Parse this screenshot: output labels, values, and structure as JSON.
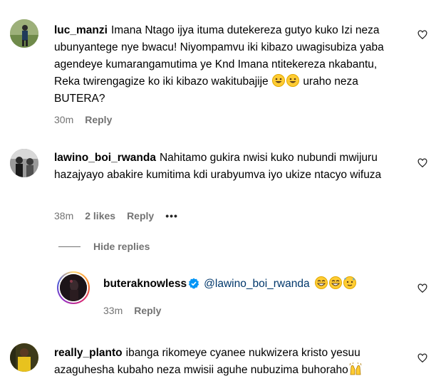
{
  "comments": [
    {
      "username": "luc_manzi",
      "text": "Imana Ntago ijya ituma dutekereza gutyo kuko Izi neza ubunyantege nye bwacu! Niyompamvu iki kibazo uwagisubiza yaba agendeye kumarangamutima ye Knd Imana ntitekereza nkabantu, Reka twirengagize ko iki kibazo wakitubajije",
      "text_after": "uraho neza BUTERA?",
      "time": "30m",
      "reply_label": "Reply"
    },
    {
      "username": "lawino_boi_rwanda",
      "text": "Nahitamo gukira nwisi kuko nubundi mwijuru hazajyayo abakire kumitima kdi urabyumva iyo ukize ntacyo wifuza",
      "time": "38m",
      "likes": "2 likes",
      "reply_label": "Reply",
      "more_label": "•••"
    },
    {
      "username": "buteraknowless",
      "mention": "@lawino_boi_rwanda",
      "time": "33m",
      "reply_label": "Reply"
    },
    {
      "username": "really_planto",
      "text": "ibanga rikomeye cyanee nukwizera kristo yesuu azaguhesha kubaho neza mwisii aguhe nubuzima buhoraho"
    }
  ],
  "hide_replies_label": "Hide replies",
  "colors": {
    "text": "#000000",
    "muted": "#737373",
    "mention": "#00376b",
    "verified": "#0095f6"
  }
}
